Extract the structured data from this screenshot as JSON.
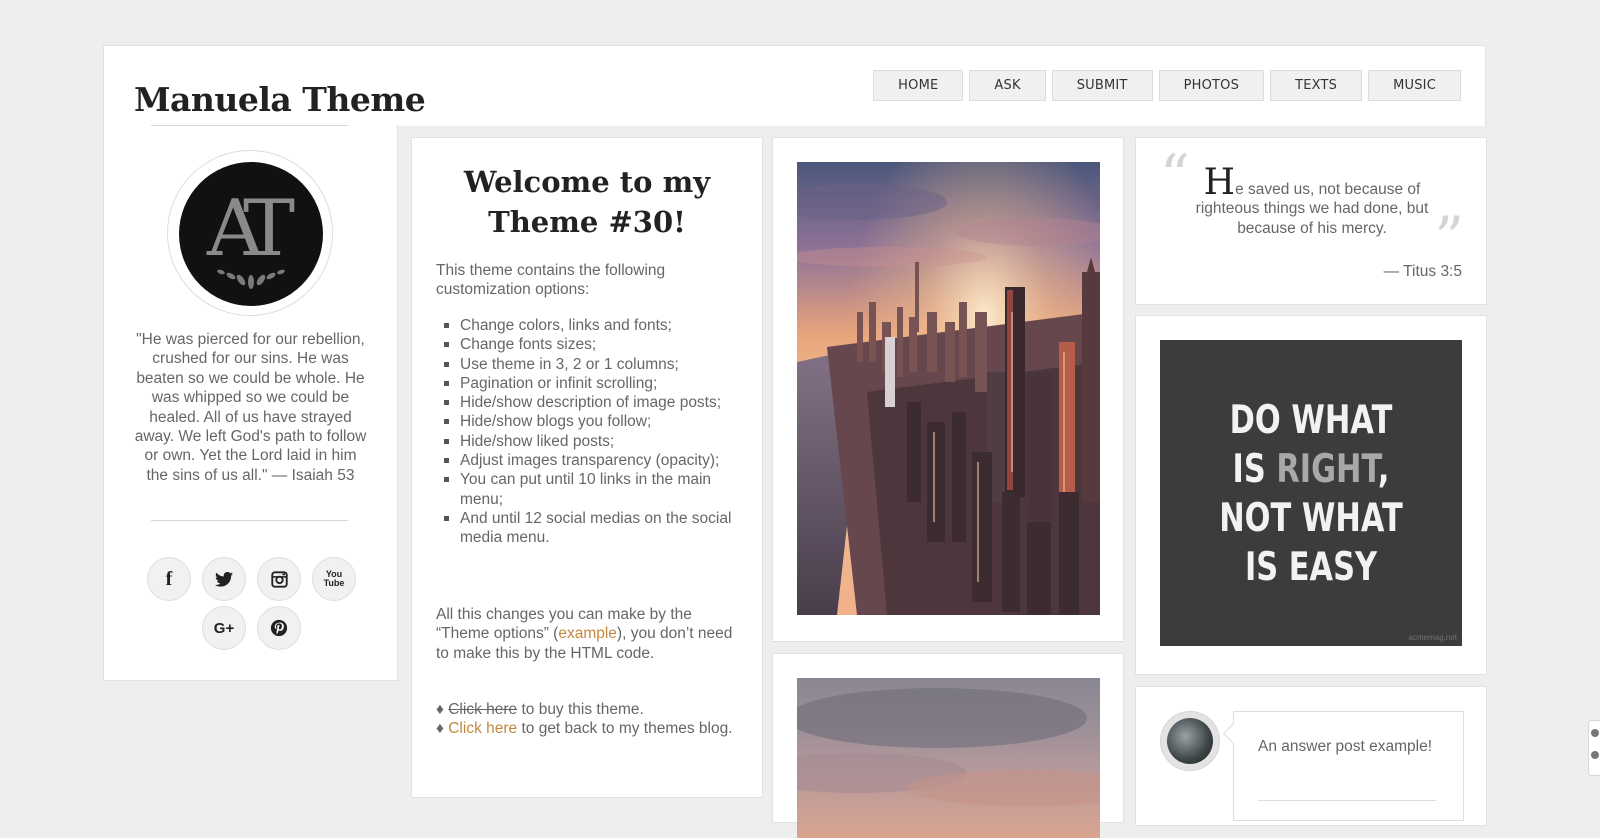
{
  "site": {
    "title": "Manuela Theme"
  },
  "nav": [
    {
      "label": "HOME"
    },
    {
      "label": "ASK"
    },
    {
      "label": "SUBMIT"
    },
    {
      "label": "PHOTOS"
    },
    {
      "label": "TEXTS"
    },
    {
      "label": "MUSIC"
    }
  ],
  "sidebar": {
    "avatar_monogram": "AT",
    "quote": "\"He was pierced for our rebellion, crushed for our sins. He was beaten so we could be whole. He was whipped so we could be healed. All of us have strayed away. We left God's path to follow or own. Yet the Lord laid in him the sins of us all.\" — Isaiah 53",
    "social": [
      {
        "icon": "facebook-icon",
        "glyph": "f"
      },
      {
        "icon": "twitter-icon",
        "glyph": "t"
      },
      {
        "icon": "instagram-icon",
        "glyph": ""
      },
      {
        "icon": "youtube-icon",
        "glyph": "You\nTube"
      },
      {
        "icon": "google-plus-icon",
        "glyph": "G+"
      },
      {
        "icon": "pinterest-icon",
        "glyph": "p"
      }
    ]
  },
  "welcome": {
    "title": "Welcome to my Theme #30!",
    "intro": "This theme contains the following customization options:",
    "features": [
      "Change colors, links and fonts;",
      "Change fonts sizes;",
      "Use theme in 3, 2 or 1 columns;",
      "Pagination or infinit scrolling;",
      "Hide/show description of image posts;",
      "Hide/show blogs you follow;",
      "Hide/show liked posts;",
      "Adjust images transparency (opacity);",
      "You can put until 10 links in the main menu;",
      "And until 12 social medias on the social media menu."
    ],
    "outro_before": "All this changes you can make by the “Theme options” (",
    "outro_link": "example",
    "outro_after": "), you don’t need to make this by the HTML code.",
    "bullet": "♦",
    "buy_link": "Click here",
    "buy_after": " to buy this theme.",
    "back_link": "Click here",
    "back_after": " to get back to my themes blog."
  },
  "quote_post": {
    "first_letter": "H",
    "text": "e saved us, not because of righteous things we had done, but because of his mercy.",
    "source": "— Titus 3:5",
    "open_mark": "“",
    "close_mark": "”"
  },
  "image_post": {
    "line1": "DO WHAT",
    "line2_a": "IS ",
    "line2_b": "RIGHT",
    "line2_c": ",",
    "line3": "NOT WHAT",
    "line4": "IS EASY",
    "credit": "acmemag.net"
  },
  "answer_post": {
    "text": "An answer post example!"
  },
  "colors": {
    "link": "#c4873f",
    "background": "#eeeeee",
    "poster": "#3c3c3c"
  }
}
